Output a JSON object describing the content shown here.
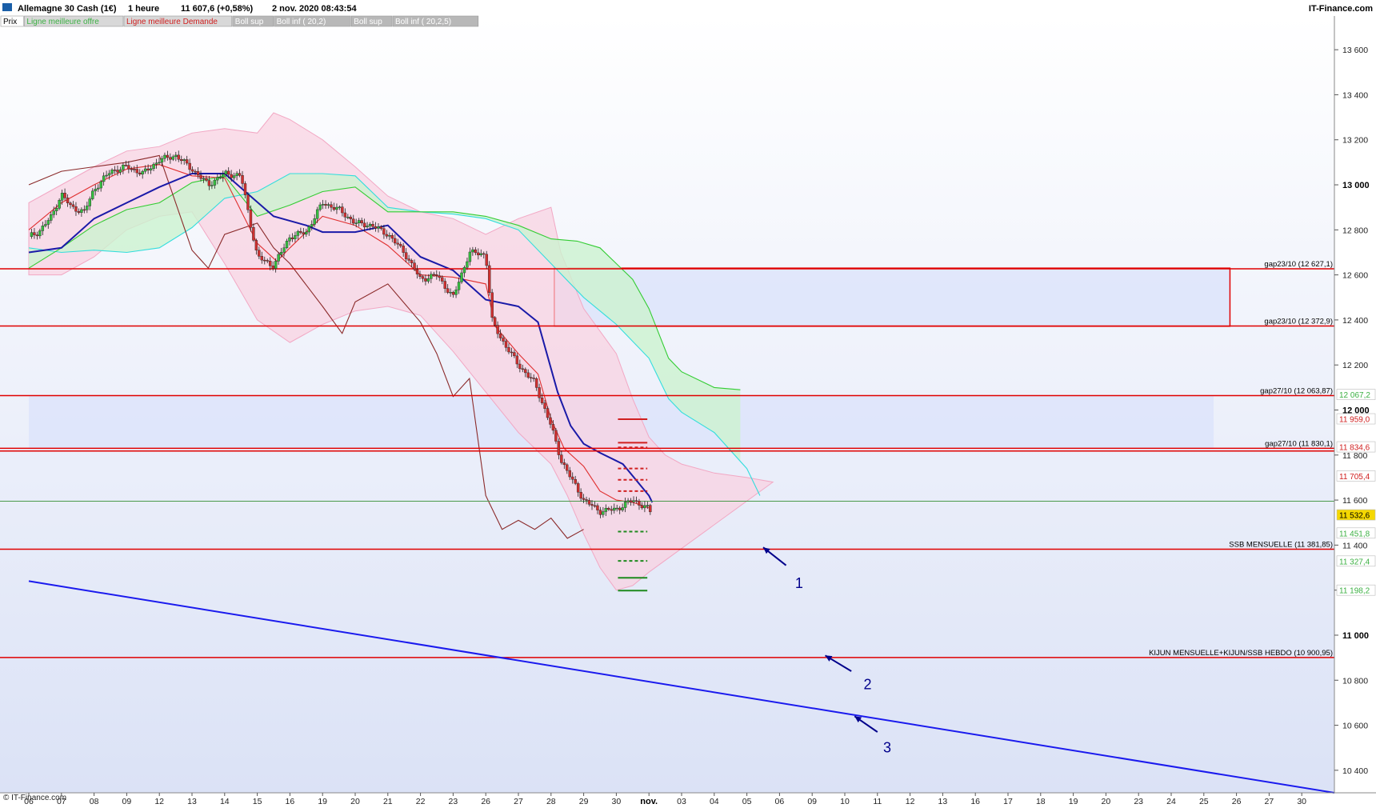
{
  "header": {
    "instrument": "Allemagne 30 Cash (1€)",
    "timeframe": "1 heure",
    "quote": "11 607,6 (+0,58%)",
    "datetime": "2 nov. 2020 08:43:54",
    "brand": "IT-Finance.com"
  },
  "legend": [
    {
      "label": "Prix",
      "color": "#000000",
      "bg": "#ffffff"
    },
    {
      "label": "Ligne meilleure offre",
      "color": "#3cb043",
      "bg": "#d8d8d8"
    },
    {
      "label": "Ligne meilleure Demande",
      "color": "#d02020",
      "bg": "#d8d8d8"
    },
    {
      "label": "Boll sup",
      "color": "#ffffff",
      "bg": "#b8b8b8"
    },
    {
      "label": "Boll inf ( 20,2)",
      "color": "#ffffff",
      "bg": "#b8b8b8"
    },
    {
      "label": "Boll sup",
      "color": "#ffffff",
      "bg": "#b8b8b8"
    },
    {
      "label": "Boll inf ( 20,2,5)",
      "color": "#ffffff",
      "bg": "#b8b8b8"
    }
  ],
  "copyright": "© IT-Finance.com",
  "colors": {
    "tenkan": "#e03030",
    "kijun": "#1a1aa8",
    "chikou": "#8b2a2a",
    "ssa": "#33cc33",
    "ssb": "#33dddd",
    "cloud": "#ccf2d0",
    "bollinger": "#f9d0e0",
    "hline": "#e00000",
    "trendline": "#1a1aee",
    "gapzone": "#dde4fa",
    "up": "#35c040",
    "down": "#d03030"
  },
  "chart_data": {
    "type": "candlestick",
    "title": "Allemagne 30 Cash (1€)",
    "xlabel": "",
    "ylabel": "",
    "ylim": [
      10300,
      13700
    ],
    "y_ticks": [
      10400,
      10600,
      10800,
      11000,
      11200,
      11400,
      11600,
      11800,
      12000,
      12200,
      12400,
      12600,
      12800,
      13000,
      13200,
      13400,
      13600
    ],
    "y_ticks_major": [
      11000,
      12000,
      13000
    ],
    "x_dates": [
      "06",
      "07",
      "08",
      "09",
      "12",
      "13",
      "14",
      "15",
      "16",
      "19",
      "20",
      "21",
      "22",
      "23",
      "26",
      "27",
      "28",
      "29",
      "30",
      "nov.",
      "03",
      "04",
      "05",
      "06",
      "09",
      "10",
      "11",
      "12",
      "13",
      "16",
      "17",
      "18",
      "19",
      "20",
      "23",
      "24",
      "25",
      "26",
      "27",
      "30"
    ],
    "last_data_day_index": 19,
    "price_path": [
      [
        0,
        12770
      ],
      [
        0.3,
        12790
      ],
      [
        0.7,
        12860
      ],
      [
        1,
        12960
      ],
      [
        1.3,
        12900
      ],
      [
        1.7,
        12880
      ],
      [
        2,
        12980
      ],
      [
        2.5,
        13060
      ],
      [
        3,
        13080
      ],
      [
        3.5,
        13050
      ],
      [
        4,
        13110
      ],
      [
        4.5,
        13130
      ],
      [
        5,
        13070
      ],
      [
        5.5,
        13000
      ],
      [
        6,
        13050
      ],
      [
        6.5,
        13040
      ],
      [
        7,
        12680
      ],
      [
        7.5,
        12640
      ],
      [
        8,
        12770
      ],
      [
        8.5,
        12790
      ],
      [
        9,
        12920
      ],
      [
        9.5,
        12890
      ],
      [
        10,
        12830
      ],
      [
        10.5,
        12820
      ],
      [
        11,
        12780
      ],
      [
        11.5,
        12700
      ],
      [
        12,
        12580
      ],
      [
        12.5,
        12600
      ],
      [
        13,
        12500
      ],
      [
        13.5,
        12700
      ],
      [
        14,
        12690
      ],
      [
        14.2,
        12390
      ],
      [
        14.5,
        12310
      ],
      [
        15,
        12200
      ],
      [
        15.5,
        12120
      ],
      [
        16,
        11930
      ],
      [
        16.3,
        11780
      ],
      [
        16.6,
        11700
      ],
      [
        17,
        11600
      ],
      [
        17.5,
        11550
      ],
      [
        18,
        11560
      ],
      [
        18.5,
        11600
      ],
      [
        19,
        11560
      ],
      [
        19.1,
        11530
      ]
    ],
    "tenkan_path": [
      [
        0,
        12800
      ],
      [
        1,
        12920
      ],
      [
        2,
        13000
      ],
      [
        3,
        13070
      ],
      [
        4,
        13090
      ],
      [
        5,
        13040
      ],
      [
        6,
        13030
      ],
      [
        7,
        12740
      ],
      [
        7.6,
        12660
      ],
      [
        8,
        12720
      ],
      [
        9,
        12860
      ],
      [
        10,
        12820
      ],
      [
        11,
        12730
      ],
      [
        12,
        12600
      ],
      [
        13,
        12590
      ],
      [
        14,
        12560
      ],
      [
        14.3,
        12370
      ],
      [
        15,
        12250
      ],
      [
        15.6,
        12160
      ],
      [
        16,
        11960
      ],
      [
        16.4,
        11830
      ],
      [
        17,
        11750
      ],
      [
        17.5,
        11640
      ],
      [
        18,
        11600
      ],
      [
        18.5,
        11590
      ],
      [
        19,
        11565
      ]
    ],
    "kijun_path": [
      [
        0,
        12700
      ],
      [
        1,
        12720
      ],
      [
        2,
        12850
      ],
      [
        3,
        12920
      ],
      [
        4,
        12990
      ],
      [
        5,
        13050
      ],
      [
        6,
        13050
      ],
      [
        7.5,
        12860
      ],
      [
        8.5,
        12820
      ],
      [
        9,
        12790
      ],
      [
        10,
        12790
      ],
      [
        11,
        12820
      ],
      [
        12,
        12680
      ],
      [
        13,
        12620
      ],
      [
        14,
        12490
      ],
      [
        15,
        12460
      ],
      [
        15.6,
        12390
      ],
      [
        16.2,
        12080
      ],
      [
        16.6,
        11930
      ],
      [
        17,
        11850
      ],
      [
        17.5,
        11810
      ],
      [
        18.2,
        11760
      ],
      [
        19,
        11620
      ],
      [
        19.1,
        11590
      ]
    ],
    "chikou_path": [
      [
        0,
        13000
      ],
      [
        1,
        13060
      ],
      [
        2,
        13080
      ],
      [
        3,
        13100
      ],
      [
        4,
        13130
      ],
      [
        5,
        12710
      ],
      [
        5.5,
        12630
      ],
      [
        6,
        12780
      ],
      [
        7,
        12830
      ],
      [
        7.5,
        12720
      ],
      [
        8,
        12650
      ],
      [
        9,
        12460
      ],
      [
        9.6,
        12340
      ],
      [
        10,
        12480
      ],
      [
        11,
        12560
      ],
      [
        12,
        12390
      ],
      [
        12.5,
        12250
      ],
      [
        13,
        12060
      ],
      [
        13.5,
        12140
      ],
      [
        14,
        11620
      ],
      [
        14.5,
        11470
      ],
      [
        15,
        11510
      ],
      [
        15.5,
        11470
      ],
      [
        16,
        11520
      ],
      [
        16.5,
        11430
      ],
      [
        17,
        11470
      ]
    ],
    "ssa_path": [
      [
        0,
        12630
      ],
      [
        1,
        12720
      ],
      [
        2,
        12820
      ],
      [
        3,
        12890
      ],
      [
        4,
        12920
      ],
      [
        5,
        13010
      ],
      [
        6,
        13040
      ],
      [
        7,
        12860
      ],
      [
        8,
        12910
      ],
      [
        9,
        12970
      ],
      [
        10,
        12990
      ],
      [
        11,
        12880
      ],
      [
        12,
        12880
      ],
      [
        13,
        12880
      ],
      [
        14,
        12860
      ],
      [
        15,
        12820
      ],
      [
        16,
        12760
      ],
      [
        16.8,
        12750
      ],
      [
        17.5,
        12720
      ],
      [
        18,
        12650
      ],
      [
        18.5,
        12580
      ],
      [
        19,
        12450
      ],
      [
        19.6,
        12230
      ],
      [
        20,
        12170
      ],
      [
        21,
        12100
      ],
      [
        21.8,
        12090
      ]
    ],
    "ssb_path": [
      [
        0,
        12720
      ],
      [
        1,
        12700
      ],
      [
        2,
        12710
      ],
      [
        3,
        12700
      ],
      [
        4,
        12720
      ],
      [
        5,
        12810
      ],
      [
        6,
        12940
      ],
      [
        7,
        12970
      ],
      [
        8,
        13050
      ],
      [
        9,
        13050
      ],
      [
        10,
        13040
      ],
      [
        11,
        12900
      ],
      [
        12,
        12880
      ],
      [
        13,
        12870
      ],
      [
        14,
        12850
      ],
      [
        15,
        12800
      ],
      [
        16,
        12650
      ],
      [
        17,
        12500
      ],
      [
        18,
        12380
      ],
      [
        19,
        12230
      ],
      [
        19.6,
        12050
      ],
      [
        20,
        11990
      ],
      [
        21,
        11900
      ],
      [
        22,
        11740
      ],
      [
        22.4,
        11620
      ]
    ],
    "boll_upper_path": [
      [
        0,
        12920
      ],
      [
        1,
        13000
      ],
      [
        2,
        13080
      ],
      [
        3,
        13150
      ],
      [
        4,
        13170
      ],
      [
        5,
        13230
      ],
      [
        6,
        13250
      ],
      [
        7,
        13230
      ],
      [
        7.5,
        13320
      ],
      [
        8,
        13290
      ],
      [
        9,
        13200
      ],
      [
        10,
        13080
      ],
      [
        11,
        12950
      ],
      [
        12,
        12880
      ],
      [
        13,
        12850
      ],
      [
        14,
        12780
      ],
      [
        15,
        12850
      ],
      [
        16,
        12900
      ],
      [
        16.3,
        12700
      ],
      [
        17,
        12450
      ],
      [
        18,
        12250
      ],
      [
        18.5,
        12050
      ],
      [
        19,
        11880
      ],
      [
        19.5,
        11800
      ],
      [
        20,
        11760
      ],
      [
        21,
        11720
      ],
      [
        22,
        11700
      ],
      [
        22.8,
        11680
      ]
    ],
    "boll_lower_path": [
      [
        0,
        12600
      ],
      [
        1,
        12600
      ],
      [
        2,
        12680
      ],
      [
        3,
        12800
      ],
      [
        4,
        12860
      ],
      [
        5,
        12880
      ],
      [
        6,
        12650
      ],
      [
        7,
        12400
      ],
      [
        8,
        12300
      ],
      [
        9,
        12380
      ],
      [
        10,
        12440
      ],
      [
        11,
        12460
      ],
      [
        12,
        12420
      ],
      [
        13,
        12260
      ],
      [
        14,
        12080
      ],
      [
        15,
        11900
      ],
      [
        16,
        11760
      ],
      [
        16.5,
        11620
      ],
      [
        17,
        11450
      ],
      [
        17.5,
        11300
      ],
      [
        18,
        11200
      ],
      [
        18.5,
        11220
      ],
      [
        19,
        11280
      ]
    ],
    "price_tags": [
      {
        "value": 12067.2,
        "label": "12 067,2",
        "color": "#3cb043",
        "bg": "#ffffff"
      },
      {
        "value": 11959.0,
        "label": "11 959,0",
        "color": "#d02020",
        "bg": "#ffffff"
      },
      {
        "value": 11834.6,
        "label": "11 834,6",
        "color": "#d02020",
        "bg": "#ffffff"
      },
      {
        "value": 11705.4,
        "label": "11 705,4",
        "color": "#d02020",
        "bg": "#ffffff"
      },
      {
        "value": 11532.6,
        "label": "11 532,6",
        "color": "#000000",
        "bg": "#f5d800"
      },
      {
        "value": 11451.8,
        "label": "11 451,8",
        "color": "#3cb043",
        "bg": "#ffffff"
      },
      {
        "value": 11327.4,
        "label": "11 327,4",
        "color": "#3cb043",
        "bg": "#ffffff"
      },
      {
        "value": 11198.2,
        "label": "11 198,2",
        "color": "#3cb043",
        "bg": "#ffffff"
      }
    ],
    "horizontal_lines": [
      {
        "value": 12627.1,
        "label": "gap23/10 (12 627,1)"
      },
      {
        "value": 12372.9,
        "label": "gap23/10 (12 372,9)"
      },
      {
        "value": 12063.87,
        "label": "gap27/10 (12 063,87)"
      },
      {
        "value": 11830.1,
        "label": "gap27/10 (11 830,1)"
      },
      {
        "value": 11818.0,
        "label": ""
      },
      {
        "value": 11381.85,
        "label": "SSB MENSUELLE (11 381,85)"
      },
      {
        "value": 10900.95,
        "label": "KIJUN MENSUELLE+KIJUN/SSB HEBDO (10 900,95)"
      }
    ],
    "gap_zones": [
      {
        "from_day": 16.1,
        "to_day": 36.8,
        "top": 12630,
        "bottom": 12372,
        "outlined": true
      },
      {
        "from_day": 0,
        "to_day": 36.3,
        "top": 12064,
        "bottom": 11830,
        "outlined": false
      }
    ],
    "green_reference_line": 11595,
    "trendline": {
      "from": [
        0,
        11240
      ],
      "to": [
        40,
        10300
      ]
    },
    "arrows": [
      {
        "label": "1",
        "tip": [
          22.5,
          11390
        ],
        "tail": [
          23.2,
          11310
        ],
        "label_at": [
          23.6,
          11210
        ]
      },
      {
        "label": "2",
        "tip": [
          24.4,
          10910
        ],
        "tail": [
          25.2,
          10840
        ],
        "label_at": [
          25.7,
          10760
        ]
      },
      {
        "label": "3",
        "tip": [
          25.3,
          10640
        ],
        "tail": [
          26.0,
          10570
        ],
        "label_at": [
          26.3,
          10480
        ]
      }
    ],
    "dashed_markers": [
      {
        "value": 11959,
        "color": "#d02020",
        "dashed": false
      },
      {
        "value": 11855,
        "color": "#d02020",
        "dashed": false
      },
      {
        "value": 11834,
        "color": "#d02020",
        "dashed": true
      },
      {
        "value": 11740,
        "color": "#d02020",
        "dashed": true
      },
      {
        "value": 11690,
        "color": "#d02020",
        "dashed": true
      },
      {
        "value": 11640,
        "color": "#d02020",
        "dashed": true
      },
      {
        "value": 11460,
        "color": "#1e8a1e",
        "dashed": true
      },
      {
        "value": 11330,
        "color": "#1e8a1e",
        "dashed": true
      },
      {
        "value": 11255,
        "color": "#1e8a1e",
        "dashed": false
      },
      {
        "value": 11198,
        "color": "#1e8a1e",
        "dashed": false
      }
    ]
  }
}
